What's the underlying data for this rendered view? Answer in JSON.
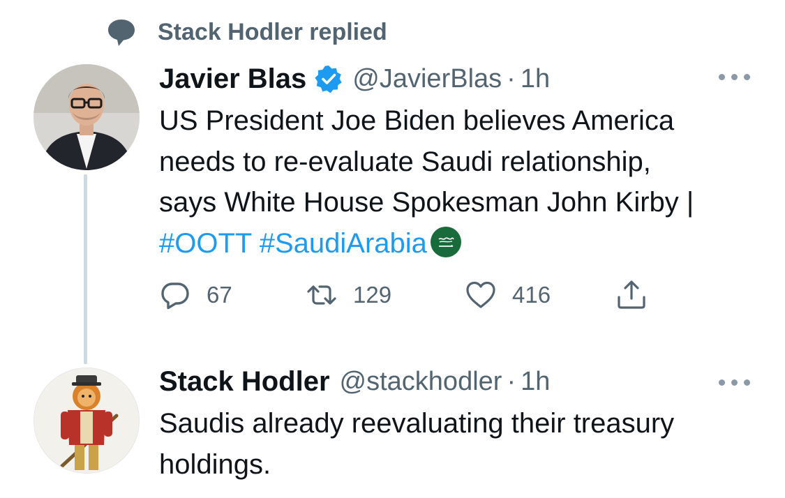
{
  "context": {
    "text": "Stack Hodler replied",
    "icon": "speech-bubble-icon"
  },
  "tweets": [
    {
      "display_name": "Javier Blas",
      "verified": true,
      "handle": "@JavierBlas",
      "separator": "·",
      "time": "1h",
      "text_lines": [
        "US President Joe Biden believes America",
        "needs to re-evaluate Saudi relationship,",
        "says White House Spokesman John Kirby |"
      ],
      "hashtags": [
        "#OOTT",
        "#SaudiArabia"
      ],
      "emoji": "saudi-arabia-flag-emoji",
      "actions": {
        "replies": "67",
        "retweets": "129",
        "likes": "416"
      }
    },
    {
      "display_name": "Stack Hodler",
      "handle": "@stackhodler",
      "separator": "·",
      "time": "1h",
      "text_lines": [
        "Saudis already reevaluating their treasury",
        "holdings."
      ]
    }
  ],
  "colors": {
    "text_primary": "#0f1419",
    "text_secondary": "#536471",
    "link_blue": "#1d9bf0",
    "verified_blue": "#1d9bf0",
    "thread_line": "#cfd9de"
  }
}
